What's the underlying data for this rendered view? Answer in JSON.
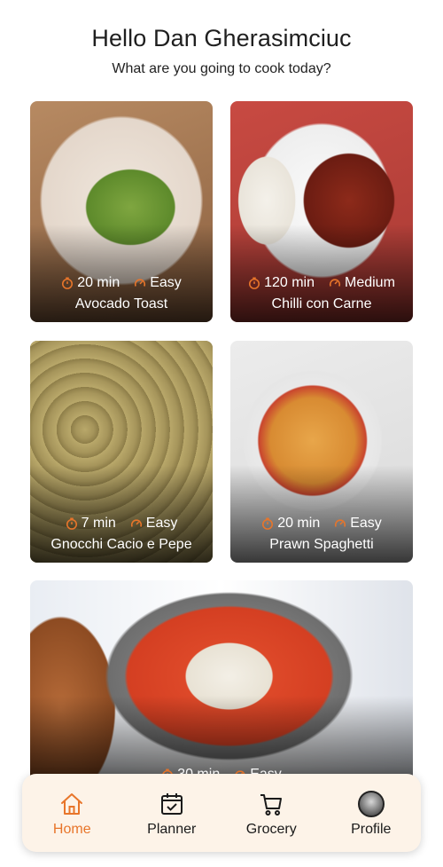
{
  "header": {
    "greeting": "Hello Dan Gherasimciuc",
    "subtitle": "What are you going to cook today?"
  },
  "recipes": [
    {
      "title": "Avocado Toast",
      "time": "20 min",
      "difficulty": "Easy"
    },
    {
      "title": "Chilli con Carne",
      "time": "120 min",
      "difficulty": "Medium"
    },
    {
      "title": "Gnocchi Cacio e Pepe",
      "time": "7 min",
      "difficulty": "Easy"
    },
    {
      "title": "Prawn Spaghetti",
      "time": "20 min",
      "difficulty": "Easy"
    },
    {
      "title": "",
      "time": "30 min",
      "difficulty": "Easy"
    }
  ],
  "icons": {
    "time": "timer-icon",
    "difficulty": "gauge-icon"
  },
  "nav": {
    "home": "Home",
    "planner": "Planner",
    "grocery": "Grocery",
    "profile": "Profile"
  },
  "colors": {
    "accent": "#e8752a",
    "nav_bg": "#fdf3e8"
  }
}
